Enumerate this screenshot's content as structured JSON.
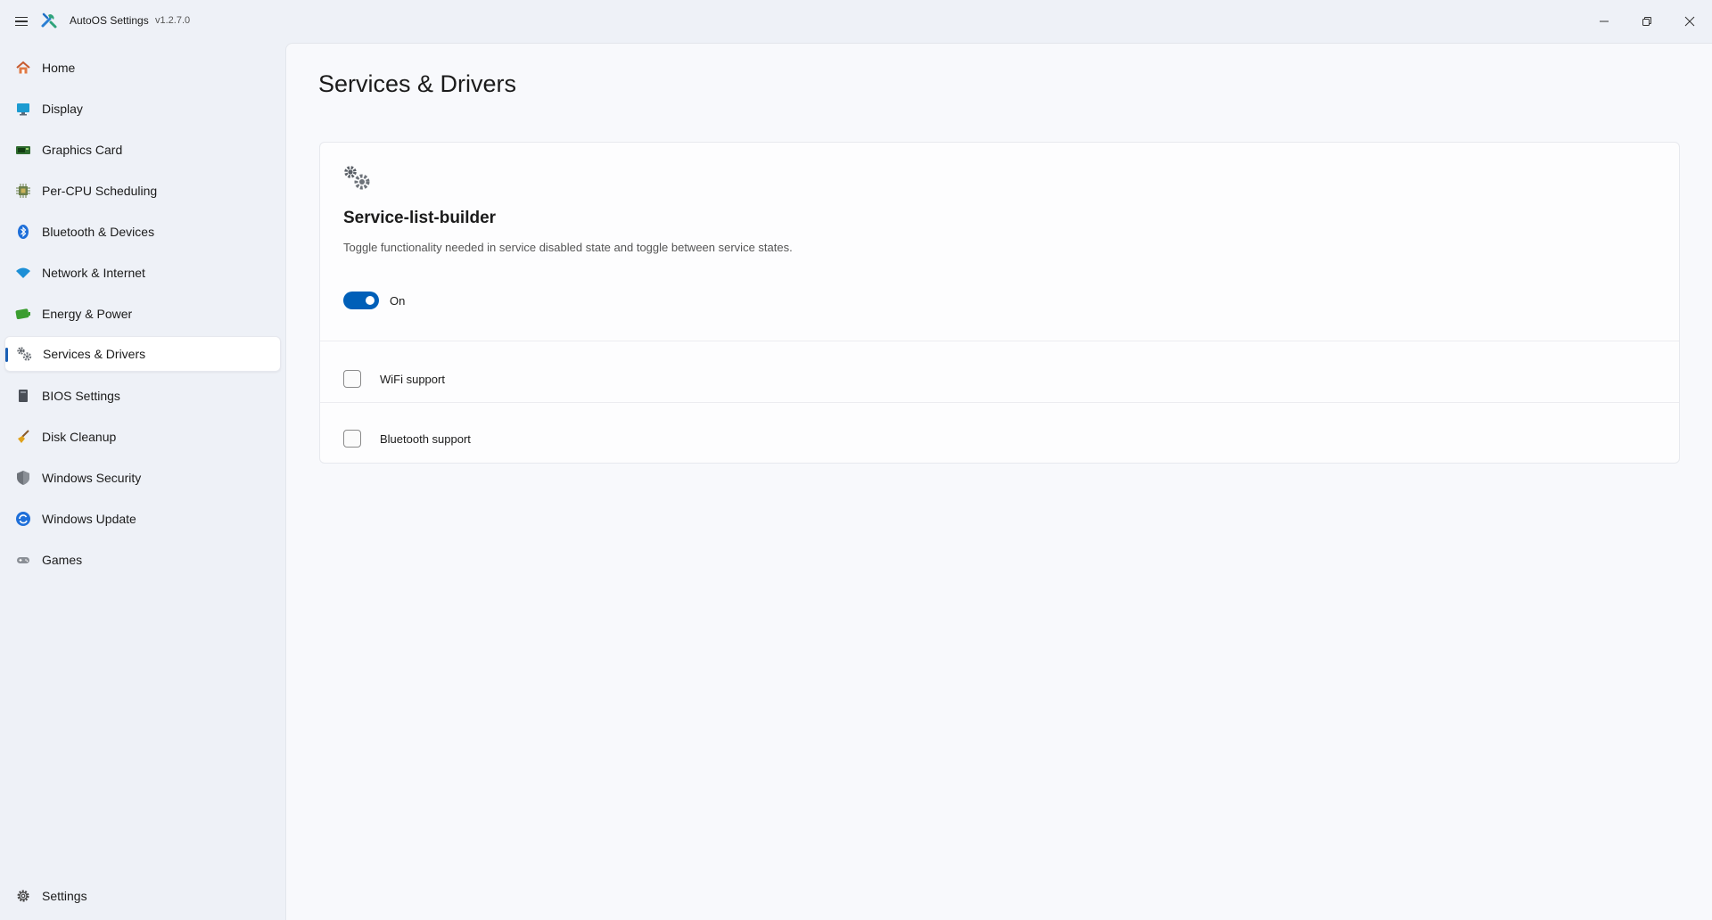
{
  "window": {
    "app_title": "AutoOS Settings",
    "version": "v1.2.7.0"
  },
  "sidebar": {
    "items": [
      {
        "label": "Home",
        "icon": "home-icon"
      },
      {
        "label": "Display",
        "icon": "display-icon"
      },
      {
        "label": "Graphics Card",
        "icon": "graphics-card-icon"
      },
      {
        "label": "Per-CPU Scheduling",
        "icon": "cpu-icon"
      },
      {
        "label": "Bluetooth & Devices",
        "icon": "bluetooth-icon"
      },
      {
        "label": "Network & Internet",
        "icon": "wifi-icon"
      },
      {
        "label": "Energy & Power",
        "icon": "battery-icon"
      },
      {
        "label": "Services & Drivers",
        "icon": "gears-icon",
        "active": true
      },
      {
        "label": "BIOS Settings",
        "icon": "bios-icon"
      },
      {
        "label": "Disk Cleanup",
        "icon": "broom-icon"
      },
      {
        "label": "Windows Security",
        "icon": "shield-icon"
      },
      {
        "label": "Windows Update",
        "icon": "update-icon"
      },
      {
        "label": "Games",
        "icon": "gamepad-icon"
      }
    ],
    "footer": {
      "label": "Settings",
      "icon": "gear-icon"
    }
  },
  "main": {
    "title": "Services & Drivers",
    "card": {
      "title": "Service-list-builder",
      "description": "Toggle functionality needed in service disabled state and toggle between service states.",
      "toggle": {
        "state": true,
        "label": "On"
      },
      "options": [
        {
          "label": "WiFi support",
          "checked": false
        },
        {
          "label": "Bluetooth support",
          "checked": false
        }
      ]
    }
  },
  "colors": {
    "accent": "#005fb8",
    "sidebar_bg": "#eef1f7",
    "content_bg": "#f8f9fc"
  }
}
